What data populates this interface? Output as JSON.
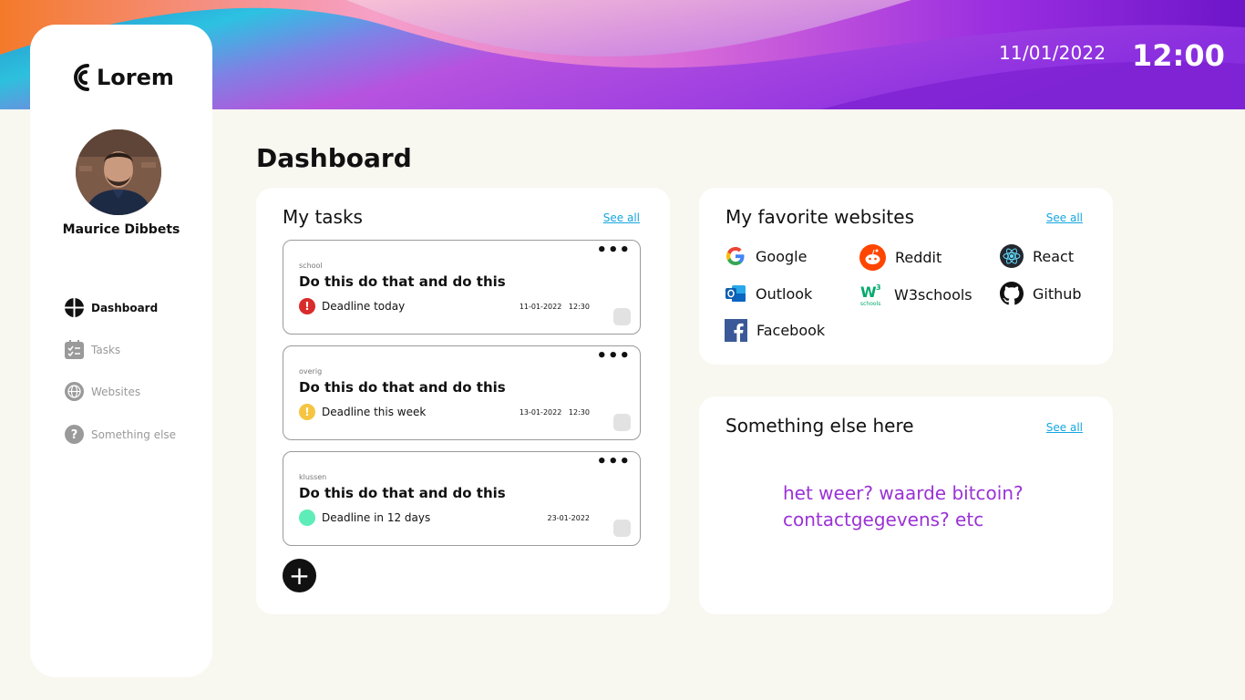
{
  "header": {
    "date": "11/01/2022",
    "time": "12:00"
  },
  "brand": {
    "name": "Lorem"
  },
  "user": {
    "name": "Maurice Dibbets"
  },
  "nav": [
    {
      "label": "Dashboard",
      "icon": "dashboard-icon",
      "active": true
    },
    {
      "label": "Tasks",
      "icon": "tasks-icon",
      "active": false
    },
    {
      "label": "Websites",
      "icon": "globe-icon",
      "active": false
    },
    {
      "label": "Something else",
      "icon": "question-icon",
      "active": false
    }
  ],
  "page": {
    "title": "Dashboard"
  },
  "tasks": {
    "title": "My tasks",
    "see_all": "See all",
    "items": [
      {
        "category": "school",
        "title": "Do this do that and do this",
        "deadline_label": "Deadline today",
        "status": "urgent",
        "status_color": "#d92b2b",
        "date": "11-01-2022   12:30"
      },
      {
        "category": "overig",
        "title": "Do this do that and do this",
        "deadline_label": "Deadline this week",
        "status": "warning",
        "status_color": "#f5c542",
        "date": "13-01-2022   12:30"
      },
      {
        "category": "klussen",
        "title": "Do this do that and do this",
        "deadline_label": "Deadline in 12 days",
        "status": "ok",
        "status_color": "#5eedb8",
        "date": "23-01-2022"
      }
    ],
    "menu_glyph": "•••",
    "add_glyph": "+"
  },
  "websites": {
    "title": "My favorite websites",
    "see_all": "See all",
    "items": [
      {
        "label": "Google",
        "icon": "google-icon"
      },
      {
        "label": "Reddit",
        "icon": "reddit-icon"
      },
      {
        "label": "React",
        "icon": "react-icon"
      },
      {
        "label": "Outlook",
        "icon": "outlook-icon"
      },
      {
        "label": "W3schools",
        "icon": "w3schools-icon"
      },
      {
        "label": "Github",
        "icon": "github-icon"
      },
      {
        "label": "Facebook",
        "icon": "facebook-icon"
      }
    ]
  },
  "other": {
    "title": "Something else here",
    "see_all": "See all",
    "text": "het weer? waarde bitcoin? contactgegevens? etc"
  },
  "colors": {
    "accent": "#17a6df",
    "purple_text": "#9b32d6",
    "background": "#f8f7f0"
  }
}
